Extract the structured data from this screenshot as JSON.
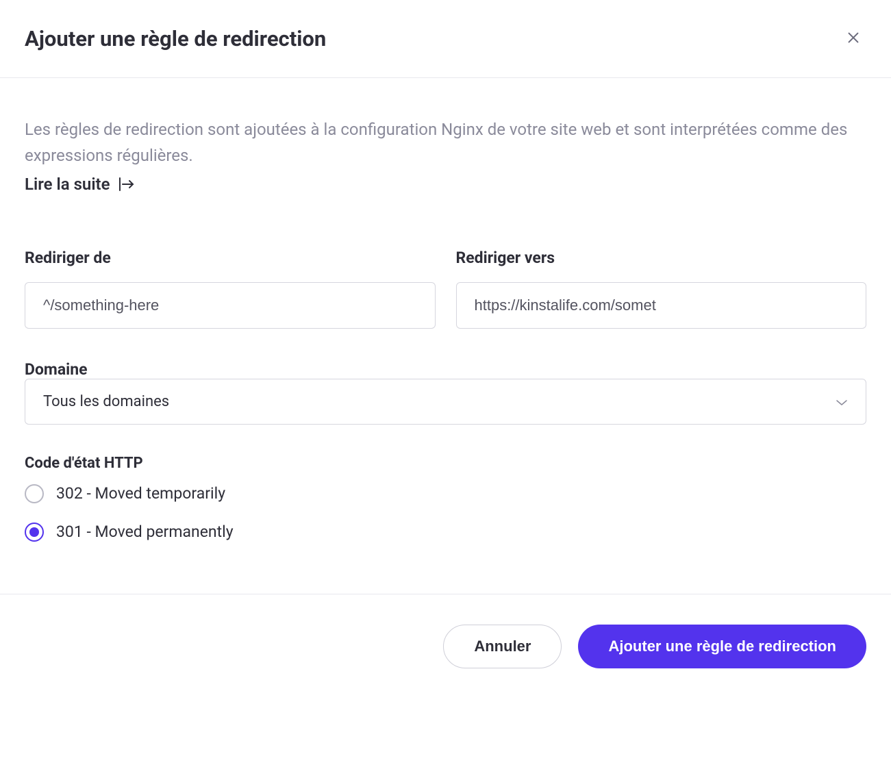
{
  "header": {
    "title": "Ajouter une règle de redirection"
  },
  "body": {
    "description": "Les règles de redirection sont ajoutées à la configuration Nginx de votre site web et sont interprétées comme des expressions régulières.",
    "read_more": "Lire la suite"
  },
  "form": {
    "redirect_from": {
      "label": "Rediriger de",
      "placeholder": "^/something-here"
    },
    "redirect_to": {
      "label": "Rediriger vers",
      "placeholder": "https://kinstalife.com/somet"
    },
    "domain": {
      "label": "Domaine",
      "selected": "Tous les domaines"
    },
    "status_code": {
      "label": "Code d'état HTTP",
      "options": [
        {
          "label": "302 - Moved temporarily",
          "selected": false
        },
        {
          "label": "301 - Moved permanently",
          "selected": true
        }
      ]
    }
  },
  "footer": {
    "cancel": "Annuler",
    "submit": "Ajouter une règle de redirection"
  }
}
